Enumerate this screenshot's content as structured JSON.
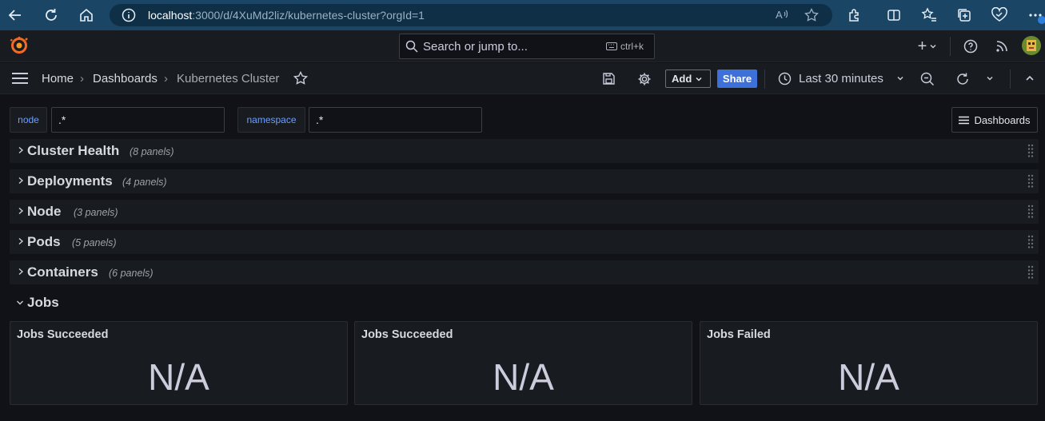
{
  "browser": {
    "url_host": "localhost",
    "url_path": ":3000/d/4XuMd2liz/kubernetes-cluster?orgId=1"
  },
  "topbar": {
    "search_placeholder": "Search or jump to...",
    "search_shortcut": "ctrl+k",
    "plus_label": "+"
  },
  "breadcrumb": {
    "home": "Home",
    "dashboards": "Dashboards",
    "current": "Kubernetes Cluster",
    "separator": "›"
  },
  "toolbar": {
    "add_label": "Add",
    "share_label": "Share",
    "time_range": "Last 30 minutes"
  },
  "variables": [
    {
      "name": "node",
      "value": ".*"
    },
    {
      "name": "namespace",
      "value": ".*"
    }
  ],
  "dashboards_button": "Dashboards",
  "rows": [
    {
      "title": "Cluster Health",
      "count": "(8 panels)"
    },
    {
      "title": "Deployments",
      "count": "(4 panels)"
    },
    {
      "title": "Node",
      "count": "(3 panels)"
    },
    {
      "title": "Pods",
      "count": "(5 panels)"
    },
    {
      "title": "Containers",
      "count": "(6 panels)"
    }
  ],
  "expanded_row": {
    "title": "Jobs"
  },
  "panels": [
    {
      "title": "Jobs Succeeded",
      "value": "N/A"
    },
    {
      "title": "Jobs Succeeded",
      "value": "N/A"
    },
    {
      "title": "Jobs Failed",
      "value": "N/A"
    }
  ],
  "colors": {
    "browser_bar": "#1a4565",
    "background": "#111217",
    "panel_bg": "#181b1f",
    "share_button": "#3d71d9",
    "variable_label": "#6e9fff"
  }
}
